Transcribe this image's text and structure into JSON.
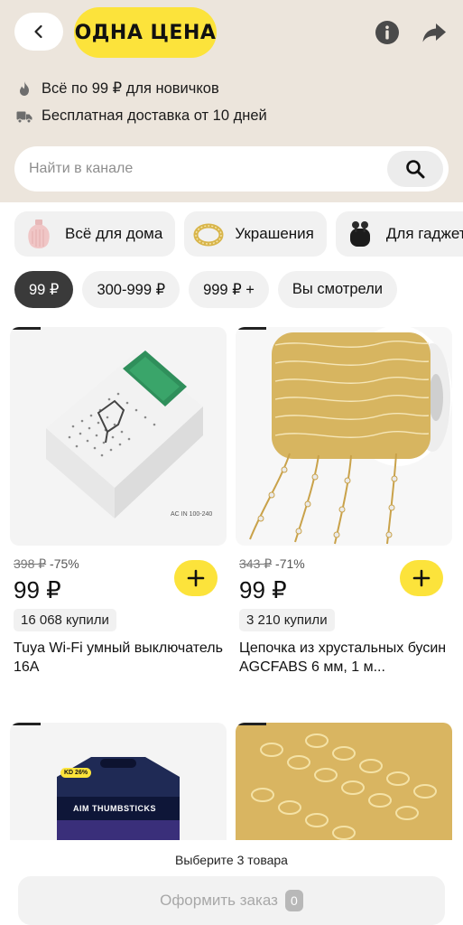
{
  "header": {
    "brand": "ОДНА ЦЕНА",
    "perks": [
      "Всё по 99 ₽ для новичков",
      "Бесплатная доставка от 10 дней"
    ]
  },
  "search": {
    "placeholder": "Найти в канале"
  },
  "categories": [
    {
      "label": "Всё для дома",
      "icon": "vase-icon"
    },
    {
      "label": "Украшения",
      "icon": "ring-icon"
    },
    {
      "label": "Для гаджет",
      "icon": "earbuds-icon"
    }
  ],
  "price_filters": [
    {
      "label": "99 ₽",
      "active": true
    },
    {
      "label": "300-999 ₽",
      "active": false
    },
    {
      "label": "999 ₽ +",
      "active": false
    },
    {
      "label": "Вы смотрели",
      "active": false
    }
  ],
  "products": [
    {
      "old_price": "398 ₽",
      "discount": "-75%",
      "price": "99 ₽",
      "bought": "16 068 купили",
      "title": "Tuya Wi-Fi умный выключатель 16А",
      "image_label": "AC IN 100-240"
    },
    {
      "old_price": "343 ₽",
      "discount": "-71%",
      "price": "99 ₽",
      "bought": "3 210 купили",
      "title": "Цепочка из хрустальных бусин AGCFABS 6 мм, 1 м..."
    },
    {
      "image_label": "AIM THUMBSTICKS",
      "image_badge": "KD 26%"
    },
    {}
  ],
  "bottom": {
    "hint": "Выберите 3 товара",
    "order_label": "Оформить заказ",
    "count": "0"
  },
  "colors": {
    "header_bg": "#ece5dc",
    "accent_yellow": "#fce33b",
    "chip_active": "#3a3a3a"
  }
}
